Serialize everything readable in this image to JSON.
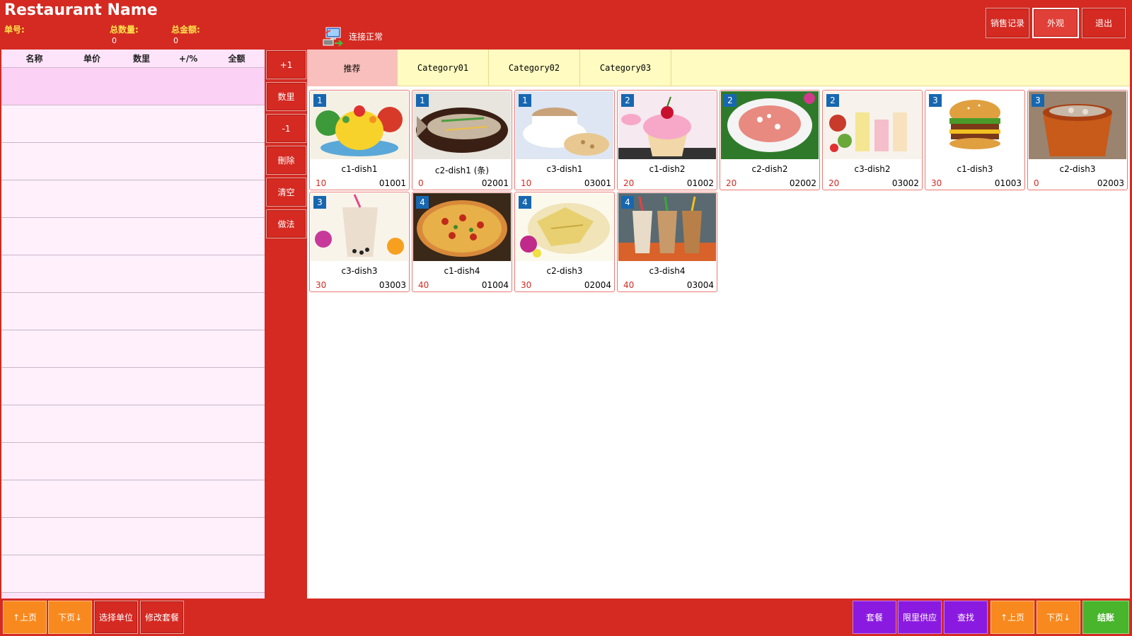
{
  "header": {
    "restaurant_name": "Restaurant Name",
    "order_no_label": "单号:",
    "total_qty_label": "总数量:",
    "total_qty_value": "0",
    "total_amount_label": "总金额:",
    "total_amount_value": "0",
    "connection_status": "连接正常",
    "buttons": {
      "sales_record": "销售记录",
      "appearance": "外观",
      "exit": "退出"
    }
  },
  "order_table": {
    "columns": [
      "名称",
      "单价",
      "数里",
      "+/%",
      "全额"
    ]
  },
  "side_buttons": [
    "+1",
    "数里",
    "-1",
    "刪除",
    "清空",
    "做法"
  ],
  "categories": [
    "推荐",
    "Category01",
    "Category02",
    "Category03"
  ],
  "dishes": [
    {
      "badge": "1",
      "name": "c1-dish1",
      "price": "10",
      "code": "01001"
    },
    {
      "badge": "1",
      "name": "c2-dish1 (条)",
      "price": "0",
      "code": "02001"
    },
    {
      "badge": "1",
      "name": "c3-dish1",
      "price": "10",
      "code": "03001"
    },
    {
      "badge": "2",
      "name": "c1-dish2",
      "price": "20",
      "code": "01002"
    },
    {
      "badge": "2",
      "name": "c2-dish2",
      "price": "20",
      "code": "02002"
    },
    {
      "badge": "2",
      "name": "c3-dish2",
      "price": "20",
      "code": "03002"
    },
    {
      "badge": "3",
      "name": "c1-dish3",
      "price": "30",
      "code": "01003"
    },
    {
      "badge": "3",
      "name": "c2-dish3",
      "price": "0",
      "code": "02003"
    },
    {
      "badge": "3",
      "name": "c3-dish3",
      "price": "30",
      "code": "03003"
    },
    {
      "badge": "4",
      "name": "c1-dish4",
      "price": "40",
      "code": "01004"
    },
    {
      "badge": "4",
      "name": "c2-dish3",
      "price": "30",
      "code": "02004"
    },
    {
      "badge": "4",
      "name": "c3-dish4",
      "price": "40",
      "code": "03004"
    }
  ],
  "bottom_left": {
    "prev_page": "↑上页",
    "next_page": "下页↓",
    "select_unit": "选择单位",
    "modify_set": "修改套餐"
  },
  "bottom_right": {
    "set_meal": "套餐",
    "limited_supply": "限里供应",
    "search": "查找",
    "prev_page": "↑上页",
    "next_page": "下页↓",
    "checkout": "结账"
  },
  "colors": {
    "background": "#d42a22",
    "order_panel": "#fde4fb",
    "category_bar": "#fffbc1",
    "active_category": "#f9bfbc",
    "badge": "#1767b0",
    "purple_button": "#8b1ae0",
    "orange_button": "#f7891e",
    "checkout_button": "#48b52c"
  }
}
